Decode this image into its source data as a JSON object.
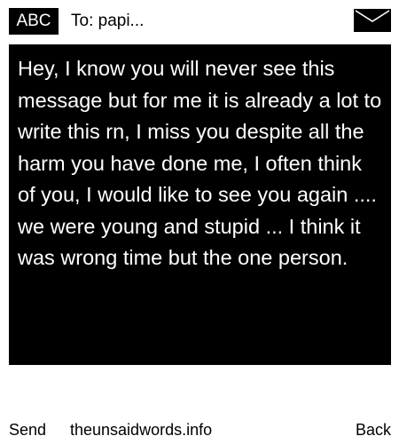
{
  "header": {
    "input_mode": "ABC",
    "recipient": "To: papi...",
    "icon": "envelope-icon"
  },
  "message": {
    "text": "Hey, I know you will never see this message but for me it is already a lot to write this rn, I miss you despite all the harm you have done me, I often think of you, I would like to see you again .... we were young and stupid ... I think it was wrong time but the one person."
  },
  "softkeys": {
    "left": "Send",
    "center": "theunsaidwords.info",
    "right": "Back"
  },
  "colors": {
    "background": "#ffffff",
    "message_background": "#000000",
    "message_text": "#ffffff",
    "text": "#000000"
  }
}
